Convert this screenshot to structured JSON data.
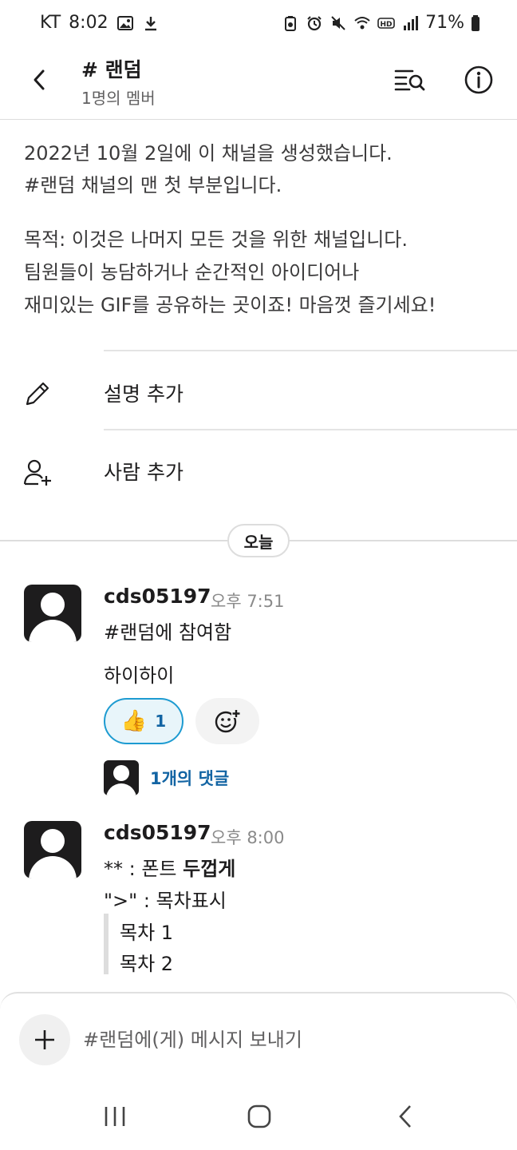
{
  "status_bar": {
    "carrier": "KT",
    "time": "8:02",
    "battery": "71%"
  },
  "header": {
    "title": "# 랜덤",
    "subtitle": "1명의 멤버"
  },
  "intro": {
    "line1": "2022년 10월 2일에 이 채널을 생성했습니다.",
    "line2": "#랜덤 채널의 맨 첫 부분입니다.",
    "purpose1": "목적: 이것은 나머지 모든 것을 위한 채널입니다.",
    "purpose2": "팀원들이 농담하거나 순간적인 아이디어나",
    "purpose3": "재미있는 GIF를 공유하는 곳이죠! 마음껏 즐기세요!"
  },
  "actions": {
    "add_description": "설명 추가",
    "add_people": "사람 추가"
  },
  "day_divider": "오늘",
  "messages": [
    {
      "author": "cds05197",
      "time": "오후 7:51",
      "system": "#랜덤에 참여함",
      "text": "하이하이",
      "reaction_emoji": "👍",
      "reaction_count": "1",
      "thread": "1개의 댓글"
    },
    {
      "author": "cds05197",
      "time": "오후 8:00",
      "line1_prefix": "** : 폰트 ",
      "line1_bold": "두껍게",
      "line2": "\">\" : 목차표시",
      "quote1": "목차 1",
      "quote2": "목차 2"
    }
  ],
  "composer": {
    "placeholder": "#랜덤에(게) 메시지 보내기"
  },
  "icons": {
    "back": "back-icon",
    "search_list": "search-list-icon",
    "info": "info-icon",
    "pencil": "pencil-icon",
    "add_person": "add-person-icon",
    "add_reaction": "add-reaction-icon",
    "plus": "plus-icon"
  },
  "colors": {
    "link": "#1264a3",
    "reaction_border": "#1d9bd1",
    "avatar": "#1d1c1d"
  }
}
